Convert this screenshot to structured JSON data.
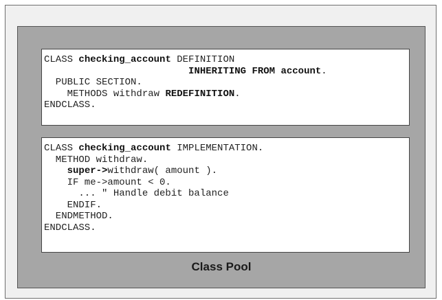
{
  "definition_block": {
    "lines": [
      [
        {
          "t": "CLASS "
        },
        {
          "t": "checking_account",
          "b": true
        },
        {
          "t": " DEFINITION"
        }
      ],
      [
        {
          "t": "                         "
        },
        {
          "t": "INHERITING FROM account",
          "b": true
        },
        {
          "t": "."
        }
      ],
      [
        {
          "t": "  PUBLIC SECTION."
        }
      ],
      [
        {
          "t": "    METHODS withdraw "
        },
        {
          "t": "REDEFINITION",
          "b": true
        },
        {
          "t": "."
        }
      ],
      [
        {
          "t": "ENDCLASS."
        }
      ]
    ]
  },
  "implementation_block": {
    "lines": [
      [
        {
          "t": "CLASS "
        },
        {
          "t": "checking_account",
          "b": true
        },
        {
          "t": " IMPLEMENTATION."
        }
      ],
      [
        {
          "t": "  METHOD withdraw."
        }
      ],
      [
        {
          "t": "    "
        },
        {
          "t": "super->",
          "b": true
        },
        {
          "t": "withdraw( amount )."
        }
      ],
      [
        {
          "t": "    IF me->amount < 0."
        }
      ],
      [
        {
          "t": "      ... \" Handle debit balance"
        }
      ],
      [
        {
          "t": "    ENDIF."
        }
      ],
      [
        {
          "t": "  ENDMETHOD."
        }
      ],
      [
        {
          "t": "ENDCLASS."
        }
      ]
    ]
  },
  "pool_label": "Class Pool"
}
